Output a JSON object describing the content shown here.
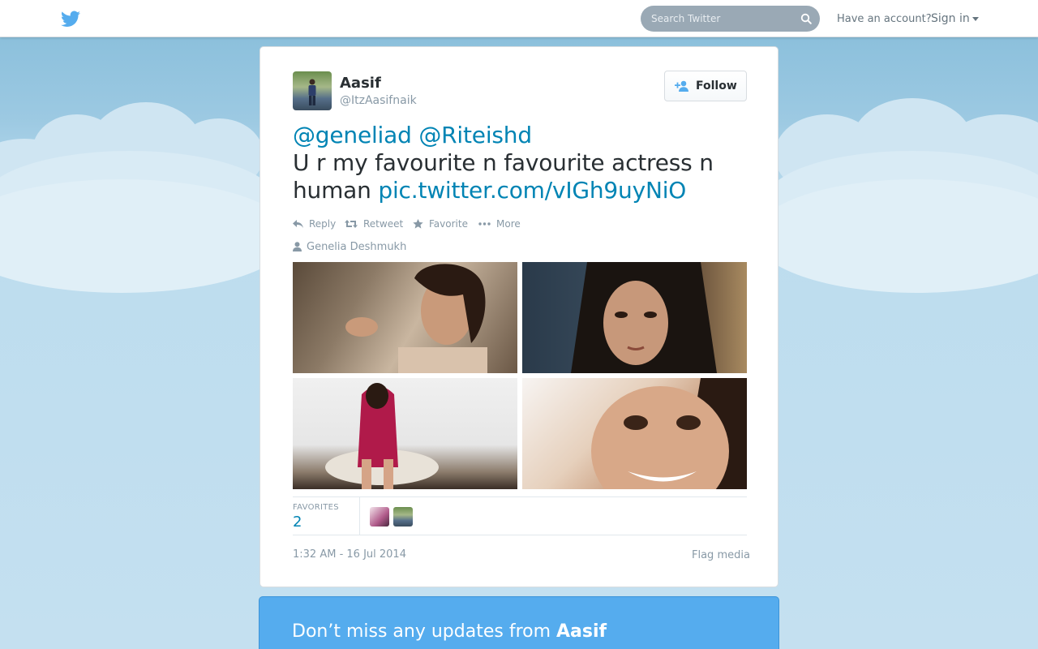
{
  "header": {
    "logo_icon": "twitter-bird-icon",
    "search_placeholder": "Search Twitter",
    "have_account": "Have an account?",
    "sign_in": "Sign in"
  },
  "tweet": {
    "author_name": "Aasif",
    "author_handle": "@ItzAasifnaik",
    "follow_label": "Follow",
    "mention1": "@geneliad",
    "mention2": "@Riteishd",
    "text": "U r my favourite n favourite actress n human",
    "link": "pic.twitter.com/vIGh9uyNiO",
    "actions": {
      "reply": "Reply",
      "retweet": "Retweet",
      "favorite": "Favorite",
      "more": "More"
    },
    "tagged_user": "Genelia Deshmukh",
    "favorites_label": "FAVORITES",
    "favorites_count": "2",
    "timestamp": "1:32 AM - 16 Jul 2014",
    "flag_media": "Flag media"
  },
  "banner": {
    "prefix": "Don’t miss any updates from ",
    "name": "Aasif"
  },
  "colors": {
    "link": "#0084b4",
    "accent": "#55acee",
    "muted": "#8899a6"
  }
}
